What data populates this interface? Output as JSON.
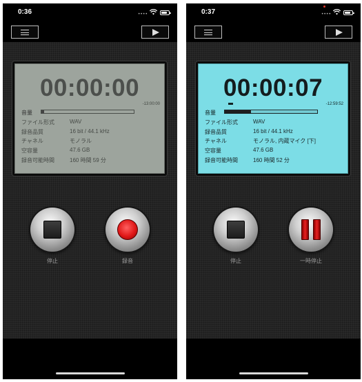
{
  "screens": [
    {
      "status_time": "0:36",
      "signal": "••••",
      "lcd_active": false,
      "counter": "00:00:00",
      "remaining": "-13:00:00",
      "level_label": "音量",
      "level_fraction": 0.03,
      "info": [
        {
          "key": "ファイル形式",
          "value": "WAV"
        },
        {
          "key": "録音品質",
          "value": "16 bit / 44.1 kHz"
        },
        {
          "key": "チャネル",
          "value": "モノラル"
        },
        {
          "key": "空容量",
          "value": "47.6 GB"
        },
        {
          "key": "録音可能時間",
          "value": "160 時間 59 分"
        }
      ],
      "left_button_label": "停止",
      "right_button_label": "録音",
      "right_button_icon": "record-icon"
    },
    {
      "status_time": "0:37",
      "signal": "••••",
      "lcd_active": true,
      "counter": "00:00:07",
      "remaining": "-12:59:52",
      "level_label": "音量",
      "level_fraction": 0.28,
      "info": [
        {
          "key": "ファイル形式",
          "value": "WAV"
        },
        {
          "key": "録音品質",
          "value": "16 bit / 44.1 kHz"
        },
        {
          "key": "チャネル",
          "value": "モノラル, 内蔵マイク [下]"
        },
        {
          "key": "空容量",
          "value": "47.6 GB"
        },
        {
          "key": "録音可能時間",
          "value": "160 時間 52 分"
        }
      ],
      "left_button_label": "停止",
      "right_button_label": "一時停止",
      "right_button_icon": "pause-icon"
    }
  ],
  "colors": {
    "lcd_idle": "#9da49d",
    "lcd_active": "#7cdde6",
    "record_red": "#e01818"
  }
}
